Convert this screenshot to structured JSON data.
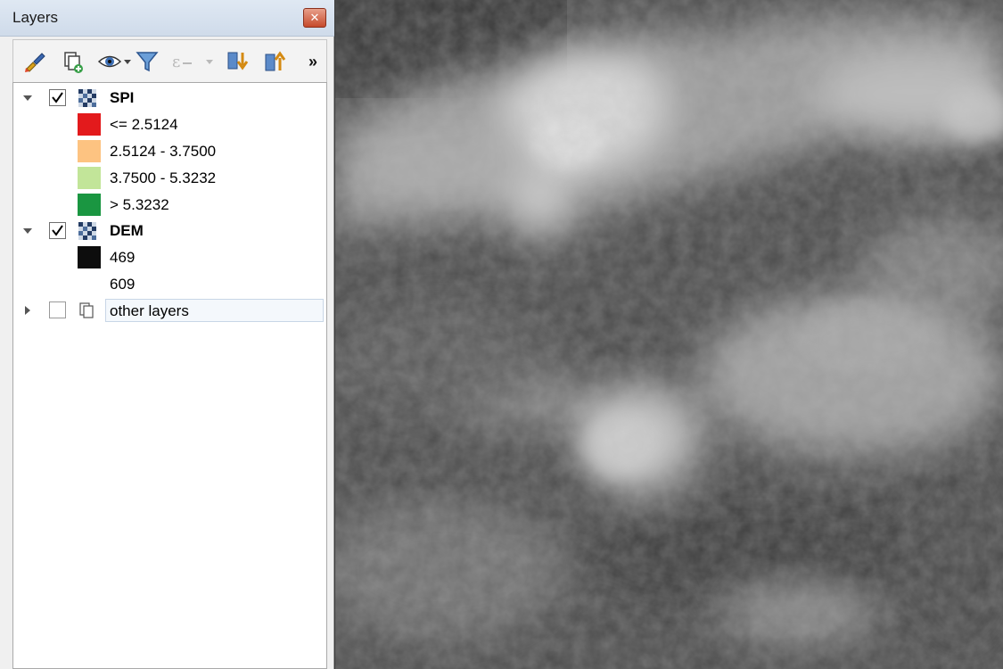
{
  "panel": {
    "title": "Layers",
    "close_icon": "close-icon",
    "toolbar": {
      "buttons": [
        {
          "name": "style-manager",
          "icon": "paintbrush-icon"
        },
        {
          "name": "add-group",
          "icon": "add-group-icon"
        },
        {
          "name": "visibility",
          "icon": "eye-icon"
        },
        {
          "name": "filter-legend",
          "icon": "filter-icon"
        },
        {
          "name": "filter-expression",
          "icon": "expression-filter-icon"
        },
        {
          "name": "expand-all",
          "icon": "expand-all-icon"
        },
        {
          "name": "collapse-all",
          "icon": "collapse-all-icon"
        }
      ],
      "more_label": "»"
    },
    "layers": [
      {
        "name": "SPI",
        "checked": true,
        "expanded": true,
        "legend": [
          {
            "label": "<= 2.5124",
            "color": "#e31a1c"
          },
          {
            "label": "2.5124 - 3.7500",
            "color": "#fdc381"
          },
          {
            "label": "3.7500 - 5.3232",
            "color": "#c2e599"
          },
          {
            "label": "> 5.3232",
            "color": "#1a9641"
          }
        ]
      },
      {
        "name": "DEM",
        "checked": true,
        "expanded": true,
        "legend": [
          {
            "label": "469",
            "color": "#0d0d0d"
          },
          {
            "label": "609",
            "color": "#ffffff"
          }
        ]
      }
    ],
    "group": {
      "name": "other layers",
      "checked": false,
      "expanded": false
    }
  }
}
